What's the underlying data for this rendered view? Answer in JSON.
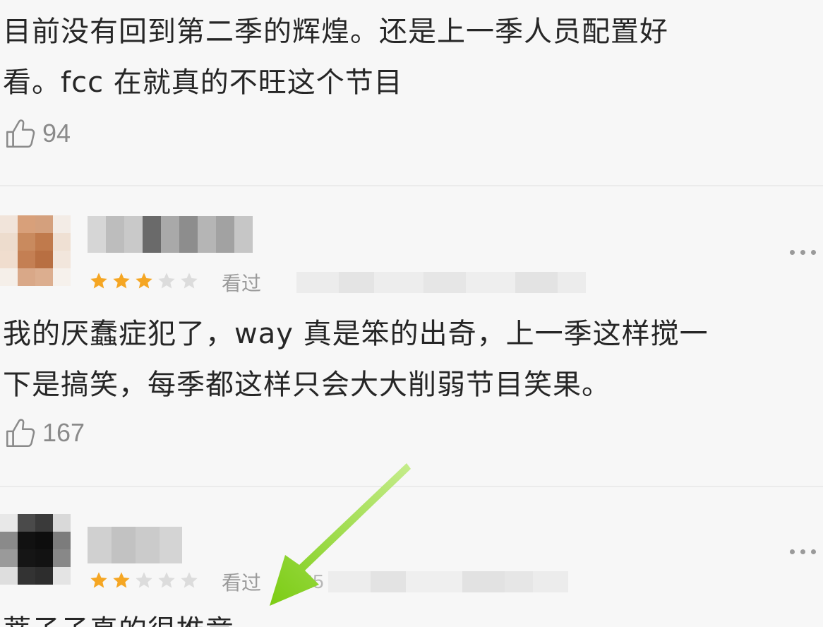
{
  "comments": [
    {
      "lines": [
        "目前没有回到第二季的辉煌。还是上一季人员配置好",
        "看。fcc 在就真的不旺这个节目"
      ],
      "likes": "94"
    },
    {
      "rating": 3,
      "watched_label": "看过",
      "date": "",
      "lines": [
        "我的厌蠢症犯了，way 真是笨的出奇，上一季这样搅一",
        "下是搞笑，每季都这样只会大大削弱节目笑果。"
      ],
      "likes": "167"
    },
    {
      "rating": 2,
      "watched_label": "看过",
      "date": "025",
      "lines": [
        "蒂子子真的很推竟"
      ]
    }
  ],
  "colors": {
    "star_filled": "#f5a623",
    "star_empty": "#dcdcdc",
    "arrow": "#8cd423"
  }
}
